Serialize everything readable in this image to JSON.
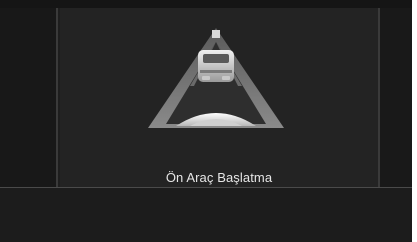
{
  "notice": {
    "label": "Ön Araç Başlatma",
    "icon": "front-vehicle-start-alert-icon"
  }
}
